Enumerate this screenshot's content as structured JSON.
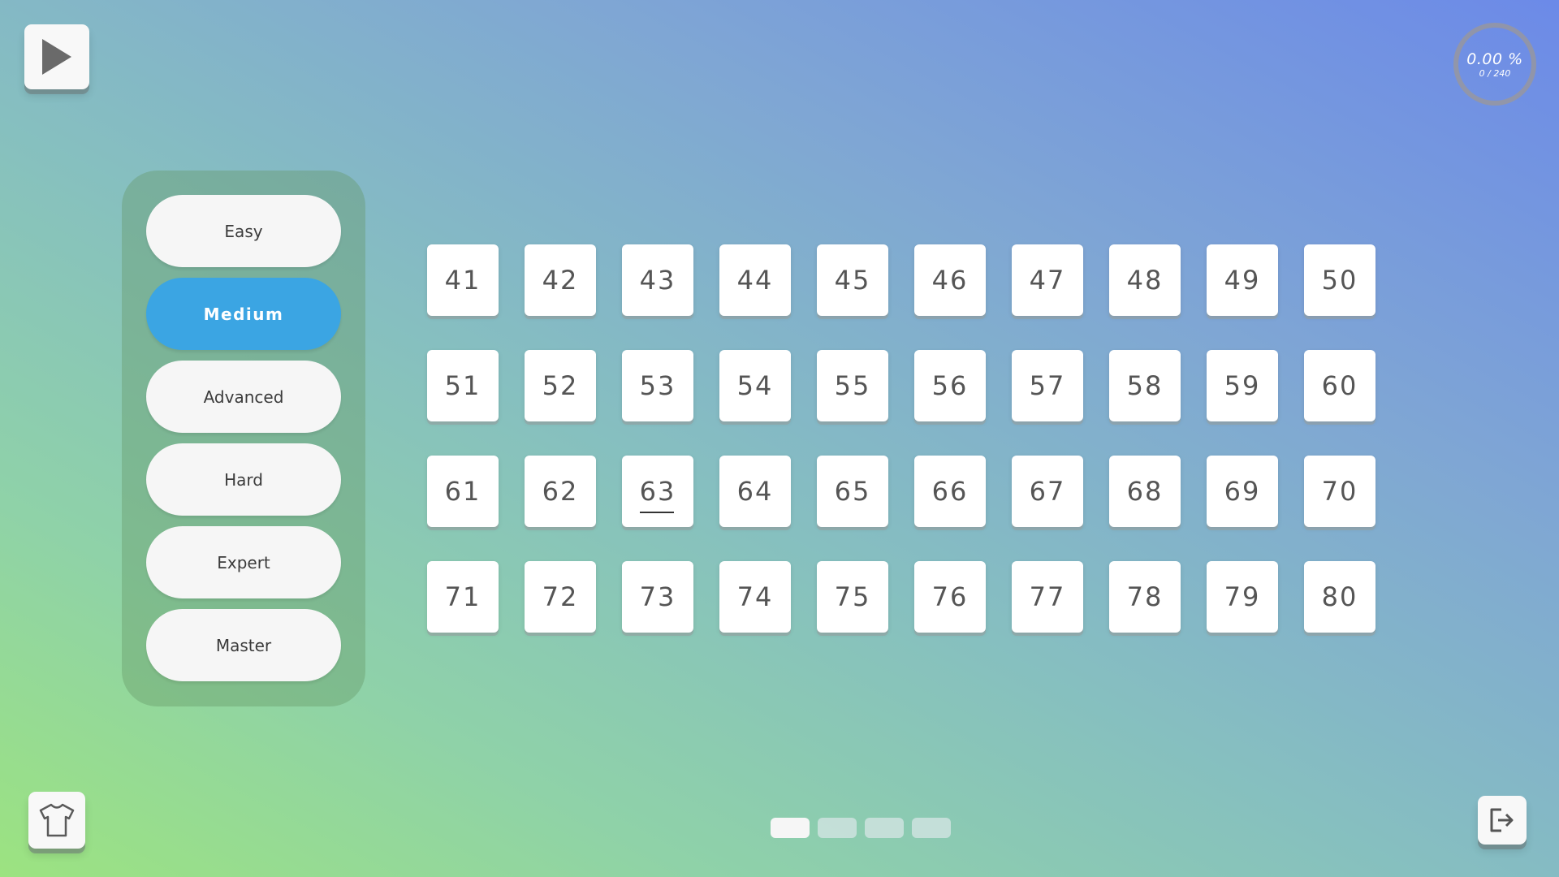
{
  "progress": {
    "percent": "0.00 %",
    "count": "0 / 240"
  },
  "difficulties": [
    {
      "label": "Easy",
      "selected": false
    },
    {
      "label": "Medium",
      "selected": true
    },
    {
      "label": "Advanced",
      "selected": false
    },
    {
      "label": "Hard",
      "selected": false
    },
    {
      "label": "Expert",
      "selected": false
    },
    {
      "label": "Master",
      "selected": false
    }
  ],
  "levels": [
    "41",
    "42",
    "43",
    "44",
    "45",
    "46",
    "47",
    "48",
    "49",
    "50",
    "51",
    "52",
    "53",
    "54",
    "55",
    "56",
    "57",
    "58",
    "59",
    "60",
    "61",
    "62",
    "63",
    "64",
    "65",
    "66",
    "67",
    "68",
    "69",
    "70",
    "71",
    "72",
    "73",
    "74",
    "75",
    "76",
    "77",
    "78",
    "79",
    "80"
  ],
  "current_level": "63",
  "pagination": {
    "total_pages": 4,
    "current_page": 1
  },
  "icons": {
    "play": "play-icon",
    "shirt": "shirt-icon",
    "exit": "exit-icon"
  },
  "colors": {
    "selected_difficulty": "#3ba5e3"
  }
}
